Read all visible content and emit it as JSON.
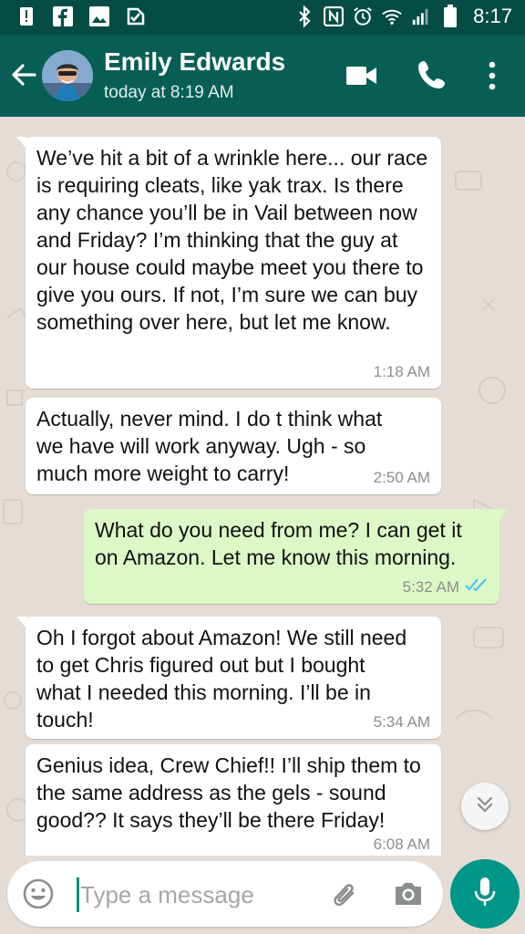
{
  "status_bar": {
    "time": "8:17",
    "left_icons": [
      "alert-icon",
      "facebook-icon",
      "image-icon",
      "check-badge-icon"
    ],
    "right_icons": [
      "bluetooth-icon",
      "nfc-icon",
      "alarm-icon",
      "wifi-icon",
      "signal-icon",
      "battery-icon"
    ]
  },
  "header": {
    "contact_name": "Emily Edwards",
    "last_seen": "today at 8:19 AM",
    "colors": {
      "bar": "#075e54",
      "status_bar": "#054d44"
    }
  },
  "messages": [
    {
      "direction": "in",
      "text": "We’ve hit a bit of a wrinkle here... our race is requiring cleats, like yak trax. Is there any chance you’ll be in Vail between now and Friday? I’m thinking that the guy at our house could maybe meet you there to give you ours. If not, I’m sure we can buy something over here, but let me know.",
      "time": "1:18 AM"
    },
    {
      "direction": "in",
      "text": "Actually, never mind. I do t think what we have will work anyway. Ugh - so much more weight to carry!",
      "time": "2:50 AM"
    },
    {
      "direction": "out",
      "text": "What do you need from me?  I can get it on Amazon.  Let me know this morning.",
      "time": "5:32 AM",
      "status": "read"
    },
    {
      "direction": "in",
      "text": "Oh I forgot about Amazon! We still need to get Chris figured out but I bought what I needed this morning. I’ll be in touch!",
      "time": "5:34 AM"
    },
    {
      "direction": "in",
      "text": "Genius idea, Crew Chief!! I’ll ship them to the same address as the gels - sound good?? It says they’ll be there Friday!",
      "time": "6:08 AM"
    }
  ],
  "composer": {
    "placeholder": "Type a message"
  },
  "colors": {
    "chat_background": "#e5ddd5",
    "incoming_bubble": "#ffffff",
    "outgoing_bubble": "#dcf8c6",
    "read_ticks": "#4fc3f7",
    "accent": "#009688"
  }
}
